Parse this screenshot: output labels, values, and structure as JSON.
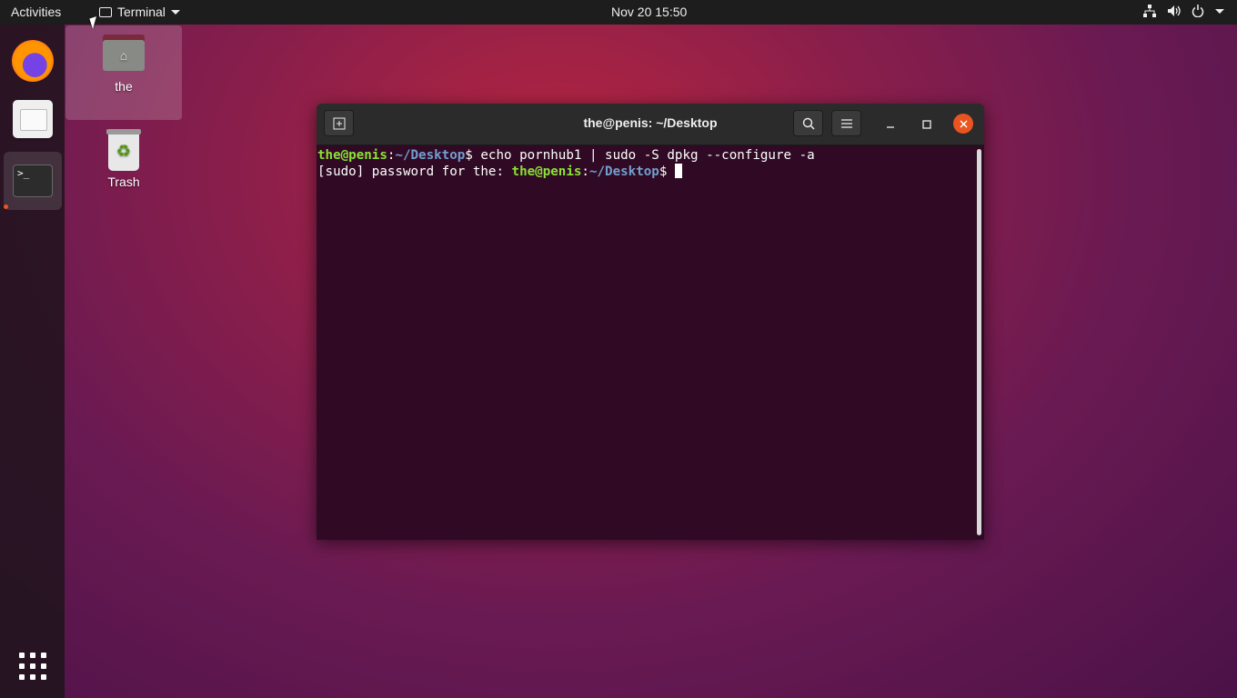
{
  "topbar": {
    "activities": "Activities",
    "app_name": "Terminal",
    "clock": "Nov 20  15:50",
    "tray_icons": [
      "network-icon",
      "volume-icon",
      "power-icon",
      "system-menu-chevron"
    ]
  },
  "dock": {
    "items": [
      {
        "name": "Firefox",
        "icon": "firefox-icon"
      },
      {
        "name": "Files",
        "icon": "files-icon"
      },
      {
        "name": "Terminal",
        "icon": "terminal-icon",
        "running": true,
        "active": true
      }
    ],
    "show_apps_icon": "app-grid-icon"
  },
  "desktop": {
    "icons": [
      {
        "label": "the",
        "icon": "home-folder-icon",
        "selected": true
      },
      {
        "label": "Trash",
        "icon": "trash-icon"
      }
    ]
  },
  "terminal": {
    "title": "the@penis: ~/Desktop",
    "line1": {
      "user_host": "the@penis",
      "sep": ":",
      "path": "~/Desktop",
      "prompt_end": "$",
      "command": " echo pornhub1 | sudo -S dpkg --configure -a"
    },
    "line2": {
      "prefix": "[sudo] password for the: ",
      "user_host": "the@penis",
      "sep": ":",
      "path": "~/Desktop",
      "prompt_end": "$ "
    }
  },
  "colors": {
    "accent": "#e95420",
    "prompt_user": "#8ae234",
    "prompt_path": "#729fcf",
    "terminal_bg": "#300a24"
  }
}
